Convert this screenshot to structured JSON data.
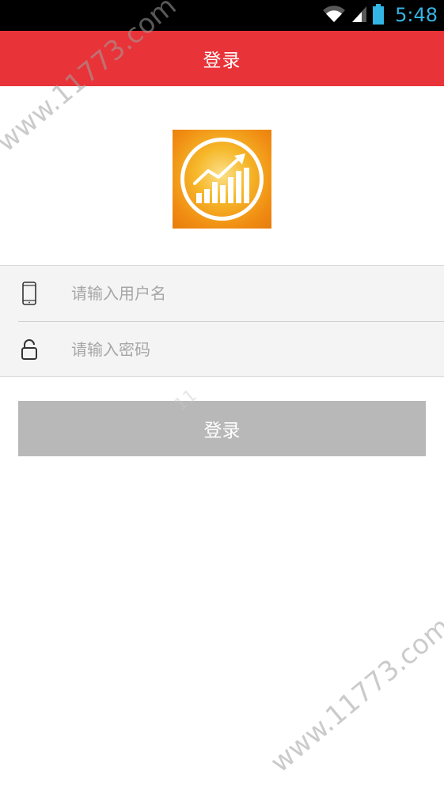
{
  "status_bar": {
    "time": "5:48",
    "icons": [
      "wifi-icon",
      "signal-icon",
      "battery-icon"
    ],
    "time_color": "#33b5e5"
  },
  "title_bar": {
    "title": "登录",
    "color": "#e83338"
  },
  "logo": {
    "icon": "growth-chart-logo",
    "colors": [
      "#f39a14",
      "#f7c21a"
    ]
  },
  "form": {
    "username": {
      "icon": "mobile-phone-icon",
      "placeholder": "请输入用户名",
      "value": ""
    },
    "password": {
      "icon": "unlock-icon",
      "placeholder": "请输入密码",
      "value": ""
    }
  },
  "login_button": {
    "label": "登录",
    "color": "#b8b8b8"
  },
  "watermark": {
    "text": "www.11773.com",
    "text_short": "11"
  }
}
